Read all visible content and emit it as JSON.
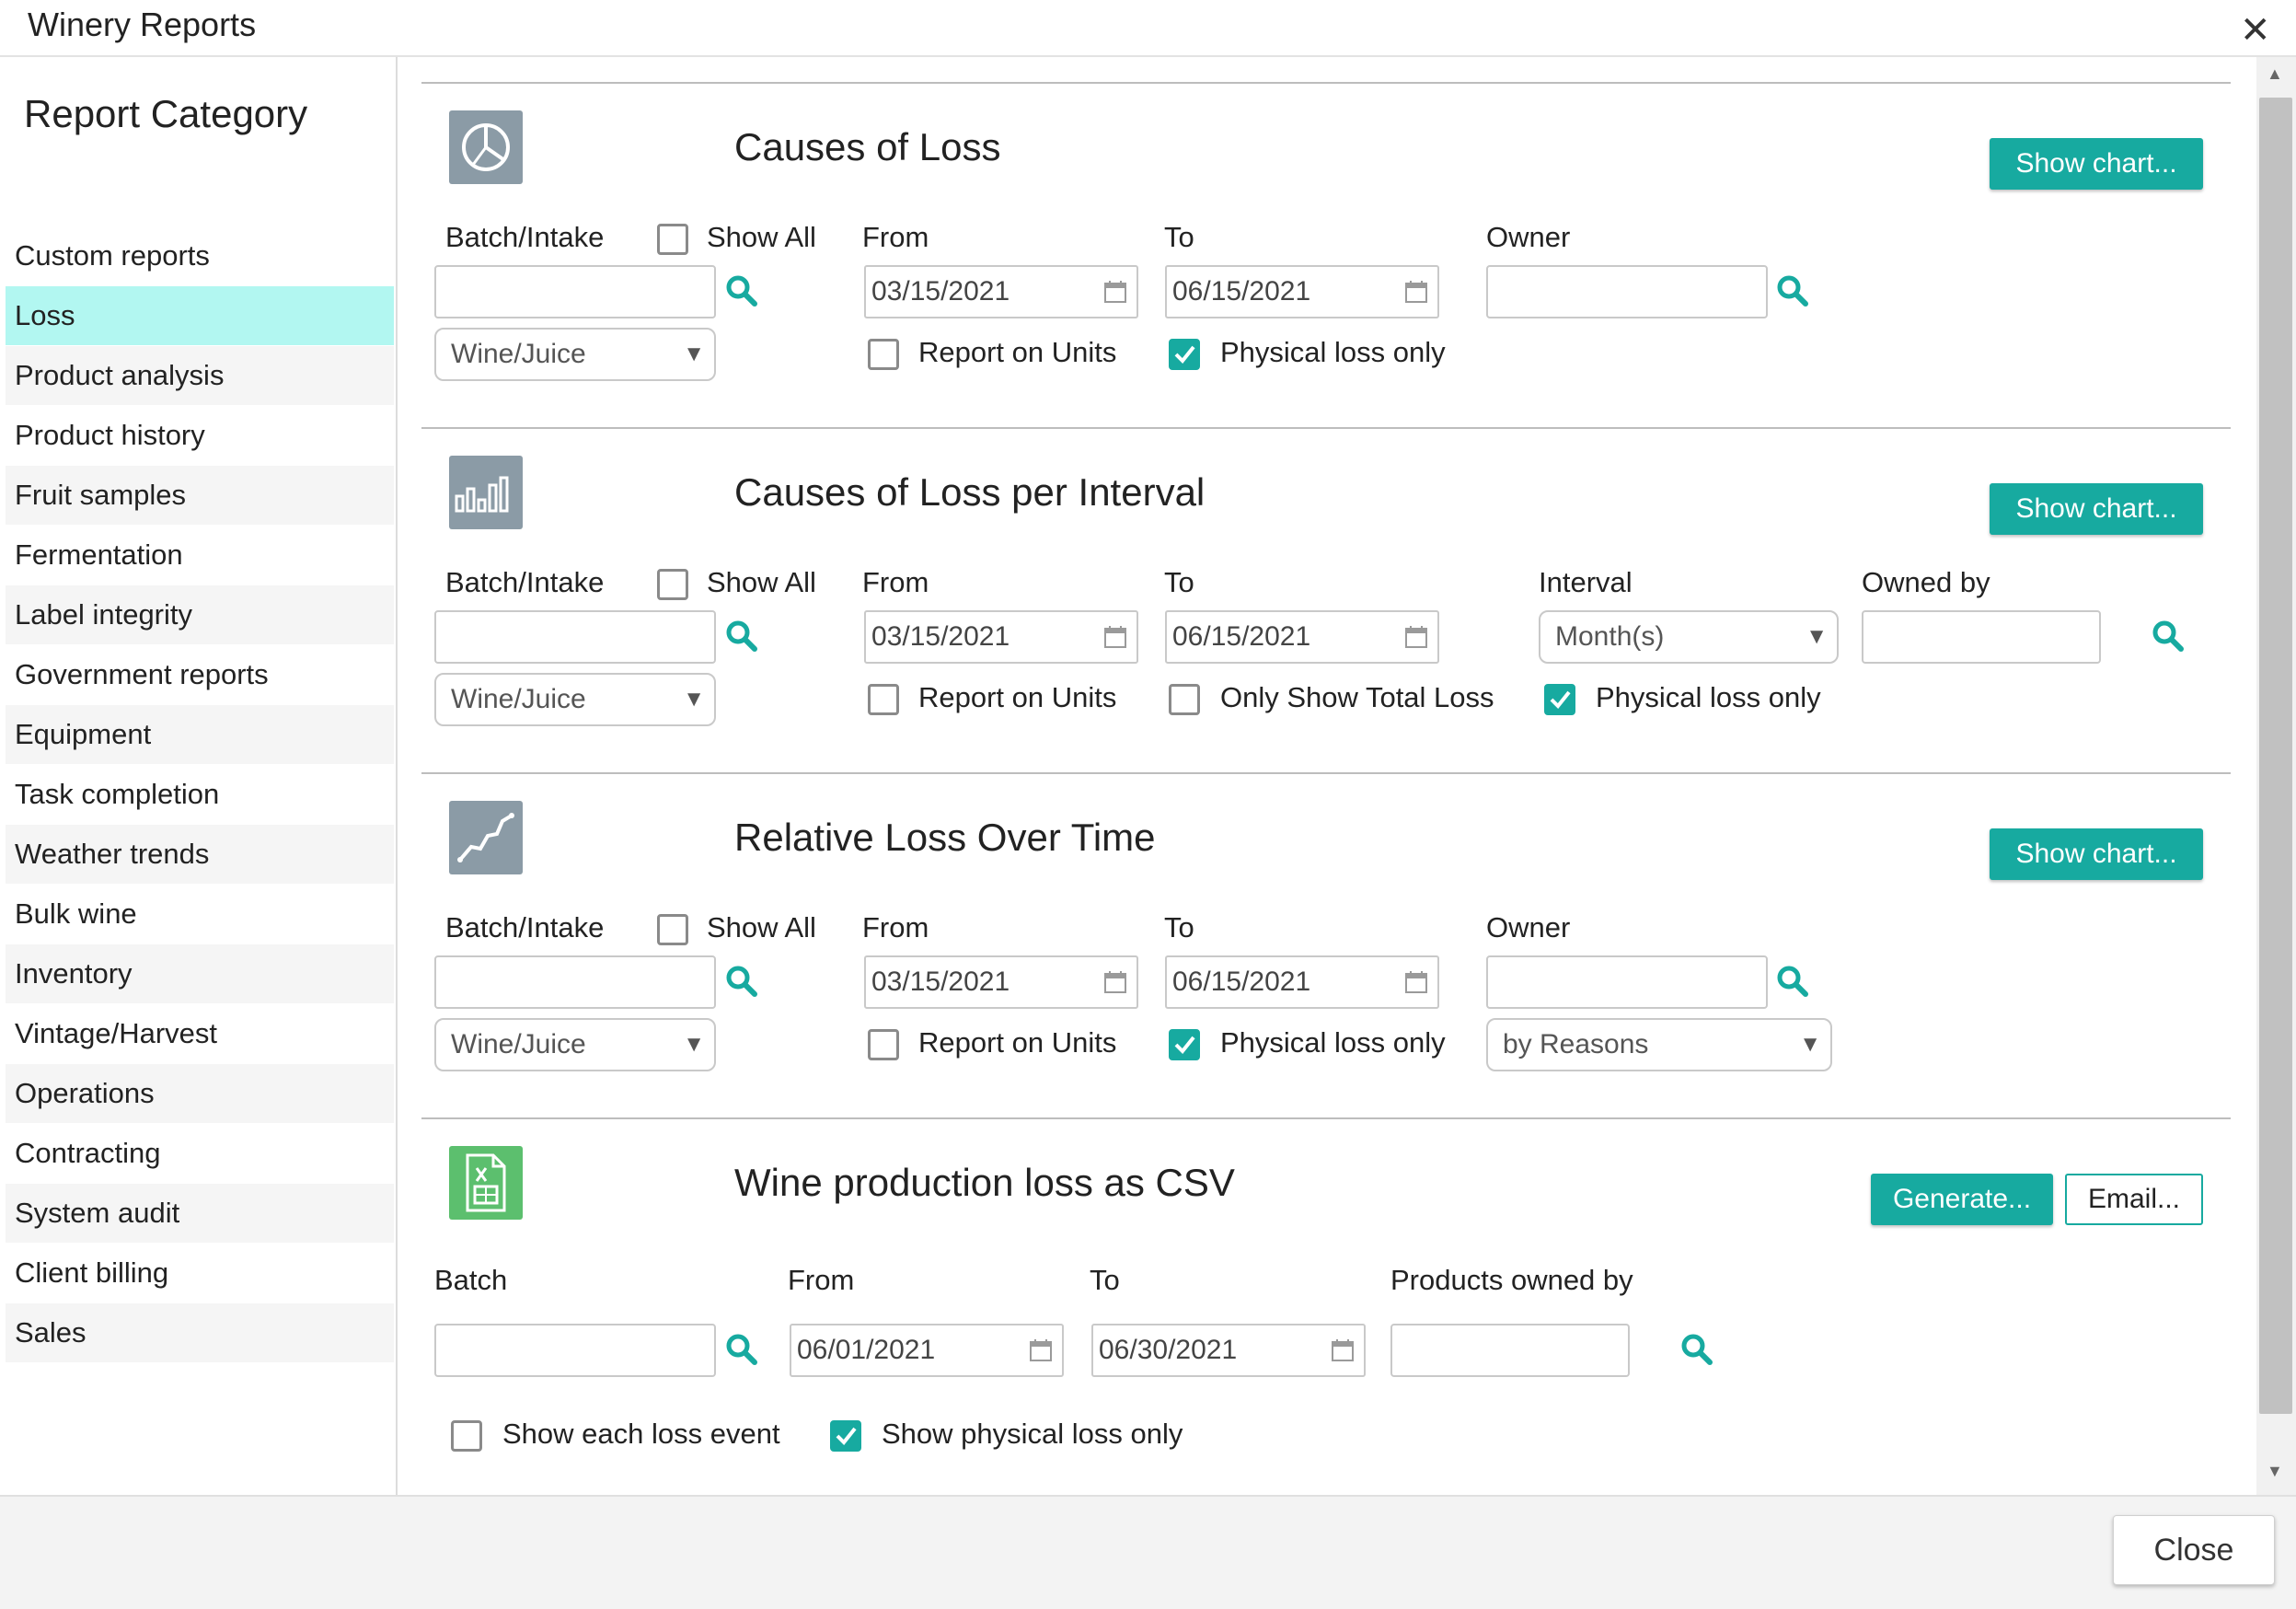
{
  "window": {
    "title": "Winery Reports"
  },
  "sidebar": {
    "heading": "Report Category",
    "selected": "Loss",
    "items": [
      "Custom reports",
      "Loss",
      "Product analysis",
      "Product history",
      "Fruit samples",
      "Fermentation",
      "Label integrity",
      "Government reports",
      "Equipment",
      "Task completion",
      "Weather trends",
      "Bulk wine",
      "Inventory",
      "Vintage/Harvest",
      "Operations",
      "Contracting",
      "System audit",
      "Client billing",
      "Sales"
    ]
  },
  "sections": {
    "causes": {
      "title": "Causes of Loss",
      "show_chart": "Show chart...",
      "batch_label": "Batch/Intake",
      "show_all": "Show All",
      "from_label": "From",
      "from_value": "03/15/2021",
      "to_label": "To",
      "to_value": "06/15/2021",
      "owner_label": "Owner",
      "type_select": "Wine/Juice",
      "report_units": "Report on Units",
      "physical_loss": "Physical loss only"
    },
    "interval": {
      "title": "Causes of Loss per Interval",
      "show_chart": "Show chart...",
      "batch_label": "Batch/Intake",
      "show_all": "Show All",
      "from_label": "From",
      "from_value": "03/15/2021",
      "to_label": "To",
      "to_value": "06/15/2021",
      "interval_label": "Interval",
      "interval_value": "Month(s)",
      "owned_by_label": "Owned by",
      "type_select": "Wine/Juice",
      "report_units": "Report on Units",
      "only_total": "Only Show Total Loss",
      "physical_loss": "Physical loss only"
    },
    "relative": {
      "title": "Relative Loss Over Time",
      "show_chart": "Show chart...",
      "batch_label": "Batch/Intake",
      "show_all": "Show All",
      "from_label": "From",
      "from_value": "03/15/2021",
      "to_label": "To",
      "to_value": "06/15/2021",
      "owner_label": "Owner",
      "type_select": "Wine/Juice",
      "report_units": "Report on Units",
      "physical_loss": "Physical loss only",
      "group_select": "by Reasons"
    },
    "csv": {
      "title": "Wine production loss as CSV",
      "generate": "Generate...",
      "email": "Email...",
      "batch_label": "Batch",
      "from_label": "From",
      "from_value": "06/01/2021",
      "to_label": "To",
      "to_value": "06/30/2021",
      "products_owned_label": "Products owned by",
      "each_event": "Show each loss event",
      "physical_only": "Show physical loss only"
    }
  },
  "footer": {
    "close": "Close"
  },
  "colors": {
    "accent": "#17aaa0",
    "selected_bg": "#b2f7f1",
    "icon_gray": "#8b9ba6",
    "icon_green": "#5cbf6e"
  },
  "icons": [
    "close-icon",
    "pie-chart-icon",
    "bar-chart-icon",
    "line-chart-icon",
    "spreadsheet-icon",
    "search-icon",
    "calendar-icon",
    "chevron-down-icon",
    "checkmark-icon"
  ]
}
